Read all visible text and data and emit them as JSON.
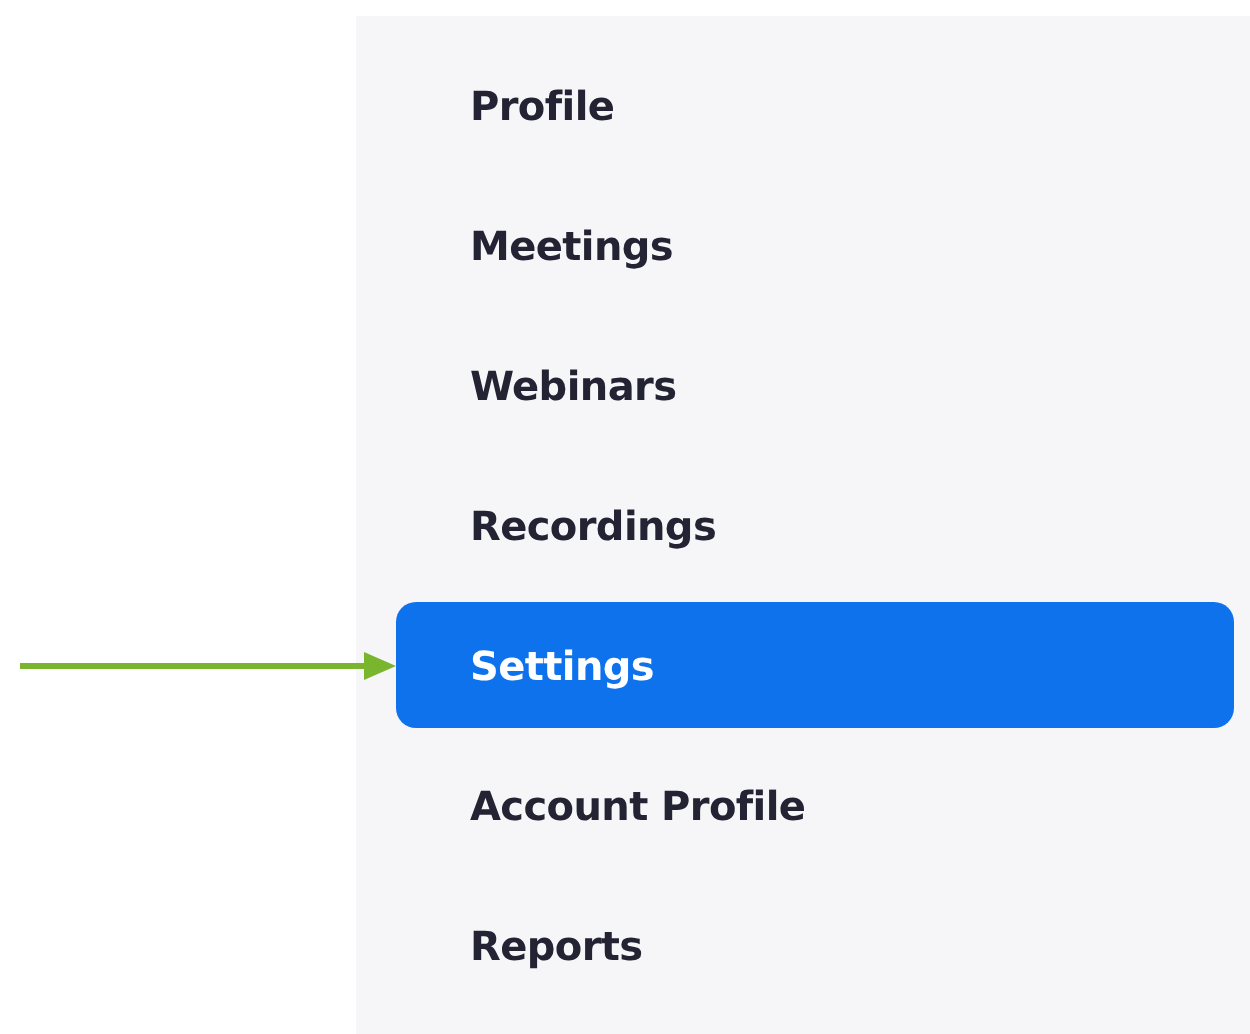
{
  "sidebar": {
    "items": [
      {
        "label": "Profile",
        "selected": false
      },
      {
        "label": "Meetings",
        "selected": false
      },
      {
        "label": "Webinars",
        "selected": false
      },
      {
        "label": "Recordings",
        "selected": false
      },
      {
        "label": "Settings",
        "selected": true
      },
      {
        "label": "Account Profile",
        "selected": false
      },
      {
        "label": "Reports",
        "selected": false
      }
    ]
  }
}
